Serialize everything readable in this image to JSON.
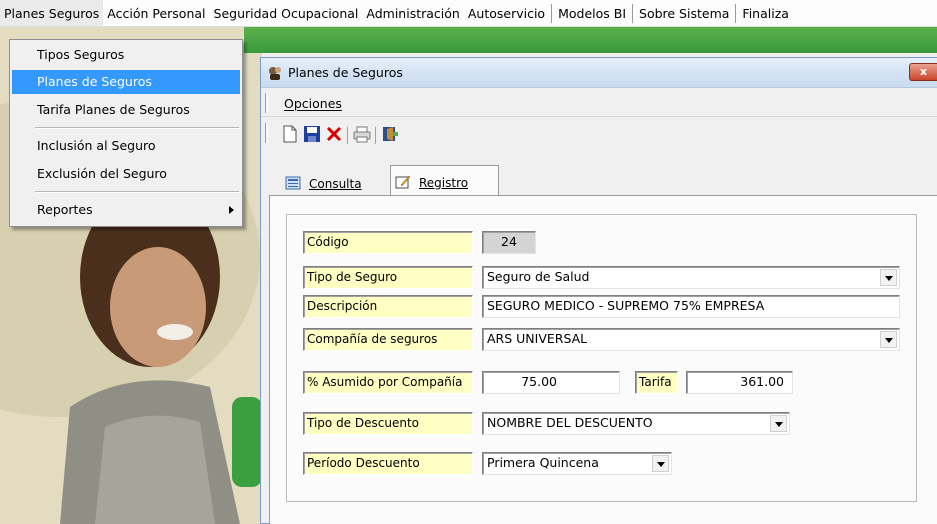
{
  "menubar": {
    "items": [
      "Planes Seguros",
      "Acción Personal",
      "Seguridad Ocupacional",
      "Administración",
      "Autoservicio",
      "Modelos BI",
      "Sobre Sistema",
      "Finaliza"
    ]
  },
  "dropdown": {
    "items": [
      "Tipos Seguros",
      "Planes de Seguros",
      "Tarifa Planes de Seguros",
      "Inclusión al Seguro",
      "Exclusión del Seguro",
      "Reportes"
    ],
    "highlighted": "Planes de Seguros"
  },
  "window": {
    "title": "Planes de Seguros",
    "close_label": "x",
    "menu_label": "Opciones",
    "toolbar_icons": [
      "new-document-icon",
      "save-icon",
      "delete-icon",
      "print-icon",
      "exit-icon"
    ]
  },
  "tabs": {
    "consulta": "Consulta",
    "registro": "Registro",
    "active": "Registro"
  },
  "form": {
    "codigo_label": "Código",
    "codigo_value": "24",
    "tipo_seguro_label": "Tipo de Seguro",
    "tipo_seguro_value": "Seguro de Salud",
    "descripcion_label": "Descripción",
    "descripcion_value": "SEGURO MEDICO - SUPREMO 75% EMPRESA",
    "compania_label": "Compañía de seguros",
    "compania_value": "ARS UNIVERSAL",
    "asumido_label": "% Asumido por Compañía",
    "asumido_value": "75.00",
    "tarifa_label": "Tarifa",
    "tarifa_value": "361.00",
    "tipo_descuento_label": "Tipo de Descuento",
    "tipo_descuento_value": "NOMBRE DEL DESCUENTO",
    "periodo_label": "Período Descuento",
    "periodo_value": "Primera Quincena"
  },
  "colors": {
    "menu_highlight": "#3399ff",
    "label_background": "#ffffc3",
    "window_title_bg": "#d4e3f4"
  }
}
